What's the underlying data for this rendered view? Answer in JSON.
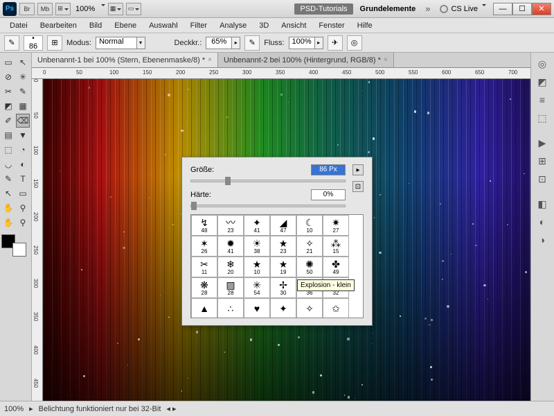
{
  "app": {
    "icon": "Ps",
    "zoom": "100%",
    "workspace_label": "PSD-Tutorials",
    "workspace_name": "Grundelemente",
    "cslive": "CS Live"
  },
  "window_btns": {
    "min": "—",
    "max": "☐",
    "close": "✕"
  },
  "menu": [
    "Datei",
    "Bearbeiten",
    "Bild",
    "Ebene",
    "Auswahl",
    "Filter",
    "Analyse",
    "3D",
    "Ansicht",
    "Fenster",
    "Hilfe"
  ],
  "options": {
    "brush_size_small": "86",
    "mode_label": "Modus:",
    "mode_value": "Normal",
    "opacity_label": "Deckkr.:",
    "opacity_value": "65%",
    "flow_label": "Fluss:",
    "flow_value": "100%"
  },
  "doc_tabs": [
    {
      "label": "Unbenannt-1 bei 100% (Stern, Ebenenmaske/8) *",
      "active": true
    },
    {
      "label": "Unbenannt-2 bei 100% (Hintergrund, RGB/8) *",
      "active": false
    }
  ],
  "ruler_top": [
    "0",
    "50",
    "100",
    "150",
    "200",
    "250",
    "300",
    "350",
    "400",
    "450",
    "500",
    "550",
    "600",
    "650",
    "700"
  ],
  "ruler_left": [
    "0",
    "50",
    "100",
    "150",
    "200",
    "250",
    "300",
    "350",
    "400",
    "450"
  ],
  "brush_panel": {
    "size_label": "Größe:",
    "size_value": "86 Px",
    "hardness_label": "Härte:",
    "hardness_value": "0%",
    "tooltip": "Explosion - klein",
    "grid": [
      [
        {
          "g": "↯",
          "n": "48"
        },
        {
          "g": "〰",
          "n": "23"
        },
        {
          "g": "✦",
          "n": "41"
        },
        {
          "g": "◢",
          "n": "47"
        },
        {
          "g": "☾",
          "n": "10"
        },
        {
          "g": "✷",
          "n": "27"
        }
      ],
      [
        {
          "g": "✶",
          "n": "26"
        },
        {
          "g": "✹",
          "n": "41"
        },
        {
          "g": "☀",
          "n": "38"
        },
        {
          "g": "★",
          "n": "23"
        },
        {
          "g": "✧",
          "n": "21"
        },
        {
          "g": "⁂",
          "n": "15"
        }
      ],
      [
        {
          "g": "✂",
          "n": "11"
        },
        {
          "g": "❄",
          "n": "20"
        },
        {
          "g": "★",
          "n": "10"
        },
        {
          "g": "★",
          "n": "19"
        },
        {
          "g": "✺",
          "n": "50"
        },
        {
          "g": "✤",
          "n": "49"
        }
      ],
      [
        {
          "g": "❋",
          "n": "28"
        },
        {
          "g": "▨",
          "n": "28"
        },
        {
          "g": "✳",
          "n": "54"
        },
        {
          "g": "✢",
          "n": "30"
        },
        {
          "g": "✥",
          "n": "36"
        },
        {
          "g": "✣",
          "n": "32"
        }
      ],
      [
        {
          "g": "▲",
          "n": ""
        },
        {
          "g": "∴",
          "n": ""
        },
        {
          "g": "♥",
          "n": ""
        },
        {
          "g": "✦",
          "n": ""
        },
        {
          "g": "✧",
          "n": ""
        },
        {
          "g": "✩",
          "n": ""
        }
      ]
    ]
  },
  "status": {
    "zoom": "100%",
    "info": "Belichtung funktioniert nur bei 32-Bit"
  },
  "tools": [
    [
      "▭",
      "↖"
    ],
    [
      "⊘",
      "✳"
    ],
    [
      "✂",
      "✎"
    ],
    [
      "◩",
      "▦"
    ],
    [
      "✐",
      "⌫"
    ],
    [
      "▤",
      "▼"
    ],
    [
      "⬚",
      "◔"
    ],
    [
      "◡",
      "◐"
    ],
    [
      "✎",
      "T"
    ],
    [
      "↖",
      "▭"
    ],
    [
      "✋",
      "⚲"
    ],
    [
      "✋",
      "⚲"
    ]
  ],
  "right_panels": [
    "◎",
    "◩",
    "≡",
    "⬚",
    "",
    "▶",
    "⊞",
    "⊡",
    "",
    "◧",
    "◐",
    "◑"
  ]
}
